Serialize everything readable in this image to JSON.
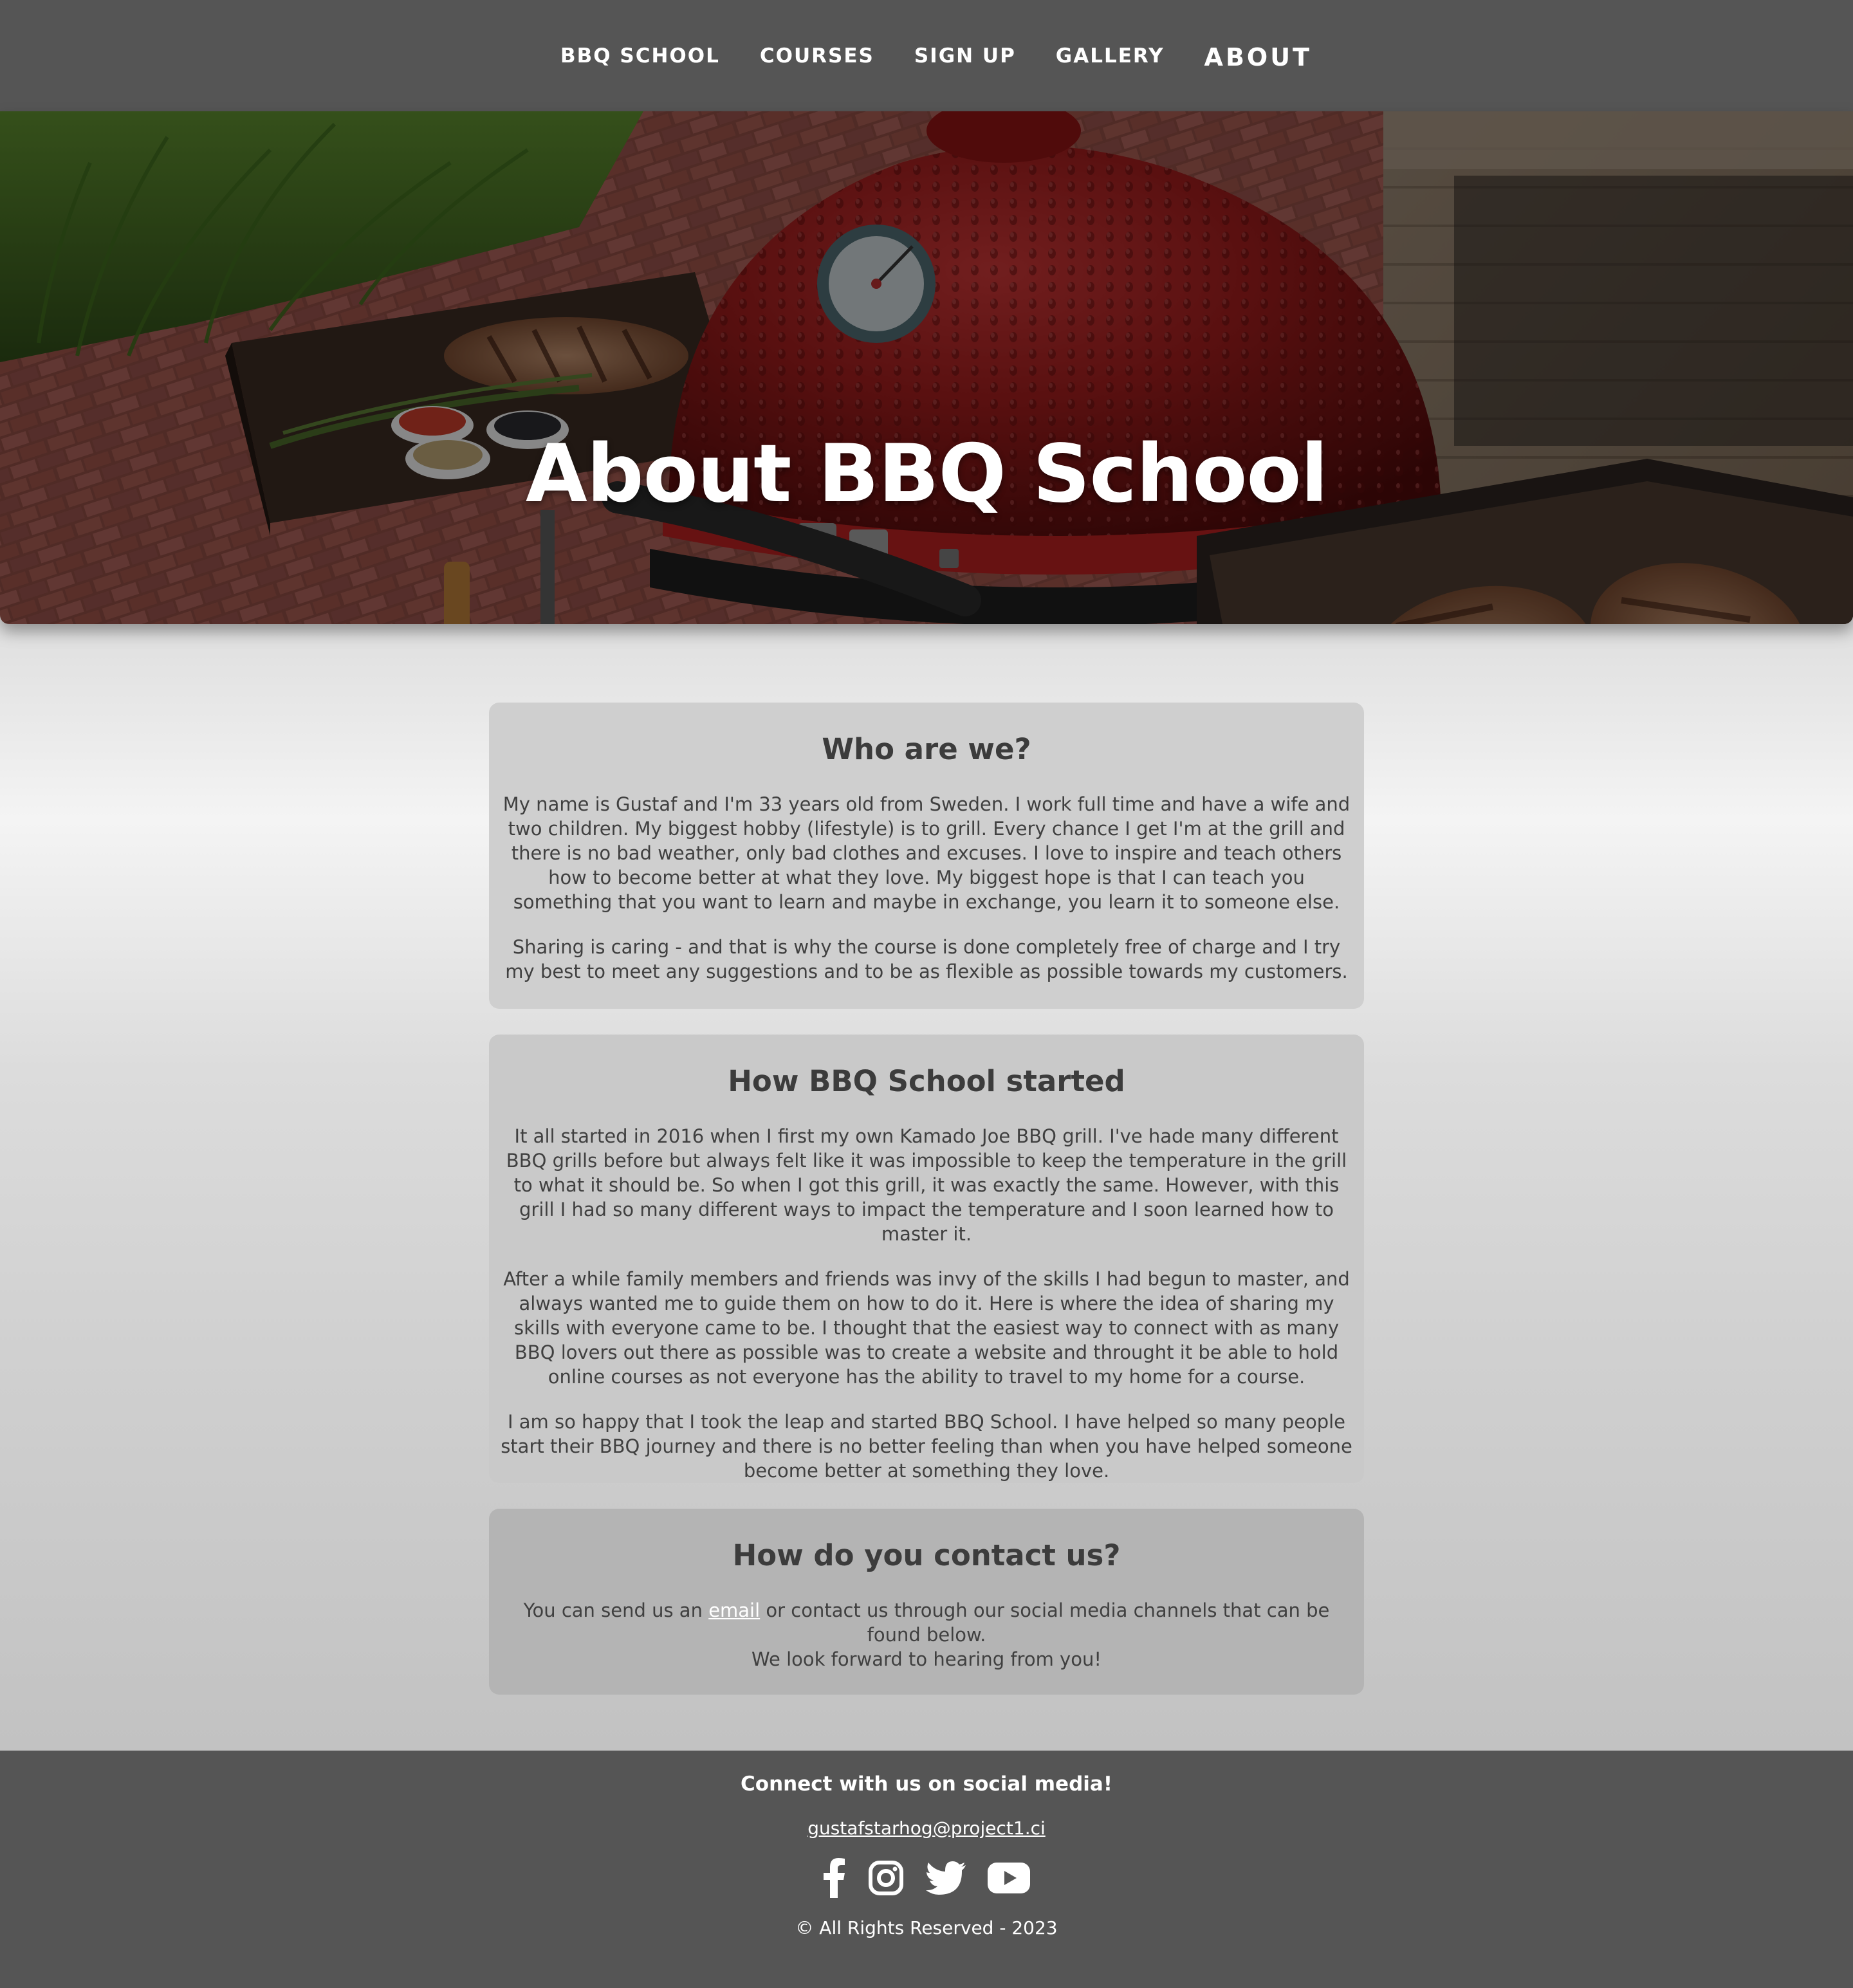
{
  "nav": {
    "items": [
      {
        "label": "BBQ SCHOOL"
      },
      {
        "label": "COURSES"
      },
      {
        "label": "SIGN UP"
      },
      {
        "label": "GALLERY"
      },
      {
        "label": "ABOUT",
        "active": true
      }
    ]
  },
  "hero": {
    "title": "About BBQ School"
  },
  "sections": [
    {
      "heading": "Who are we?",
      "paragraphs": [
        "My name is Gustaf and I'm 33 years old from Sweden. I work full time and have a wife and two children. My biggest hobby (lifestyle) is to grill. Every chance I get I'm at the grill and there is no bad weather, only bad clothes and excuses. I love to inspire and teach others how to become better at what they love. My biggest hope is that I can teach you something that you want to learn and maybe in exchange, you learn it to someone else.",
        "Sharing is caring - and that is why the course is done completely free of charge and I try my best to meet any suggestions and to be as flexible as possible towards my customers."
      ]
    },
    {
      "heading": "How BBQ School started",
      "paragraphs": [
        "It all started in 2016 when I first my own Kamado Joe BBQ grill. I've hade many different BBQ grills before but always felt like it was impossible to keep the temperature in the grill to what it should be. So when I got this grill, it was exactly the same. However, with this grill I had so many different ways to impact the temperature and I soon learned how to master it.",
        "After a while family members and friends was invy of the skills I had begun to master, and always wanted me to guide them on how to do it. Here is where the idea of sharing my skills with everyone came to be. I thought that the easiest way to connect with as many BBQ lovers out there as possible was to create a website and throught it be able to hold online courses as not everyone has the ability to travel to my home for a course.",
        "I am so happy that I took the leap and started BBQ School. I have helped so many people start their BBQ journey and there is no better feeling than when you have helped someone become better at something they love."
      ]
    },
    {
      "heading": "How do you contact us?",
      "before_link": "You can send us an ",
      "link": "email",
      "after_link": " or contact us through our social media channels that can be found below.",
      "closing": "We look forward to hearing from you!"
    }
  ],
  "footer": {
    "connect": "Connect with us on social media!",
    "email": "gustafstarhog@project1.ci",
    "socials": [
      "facebook-icon",
      "instagram-icon",
      "twitter-icon",
      "youtube-icon"
    ],
    "rights": "© All Rights Reserved - 2023"
  }
}
